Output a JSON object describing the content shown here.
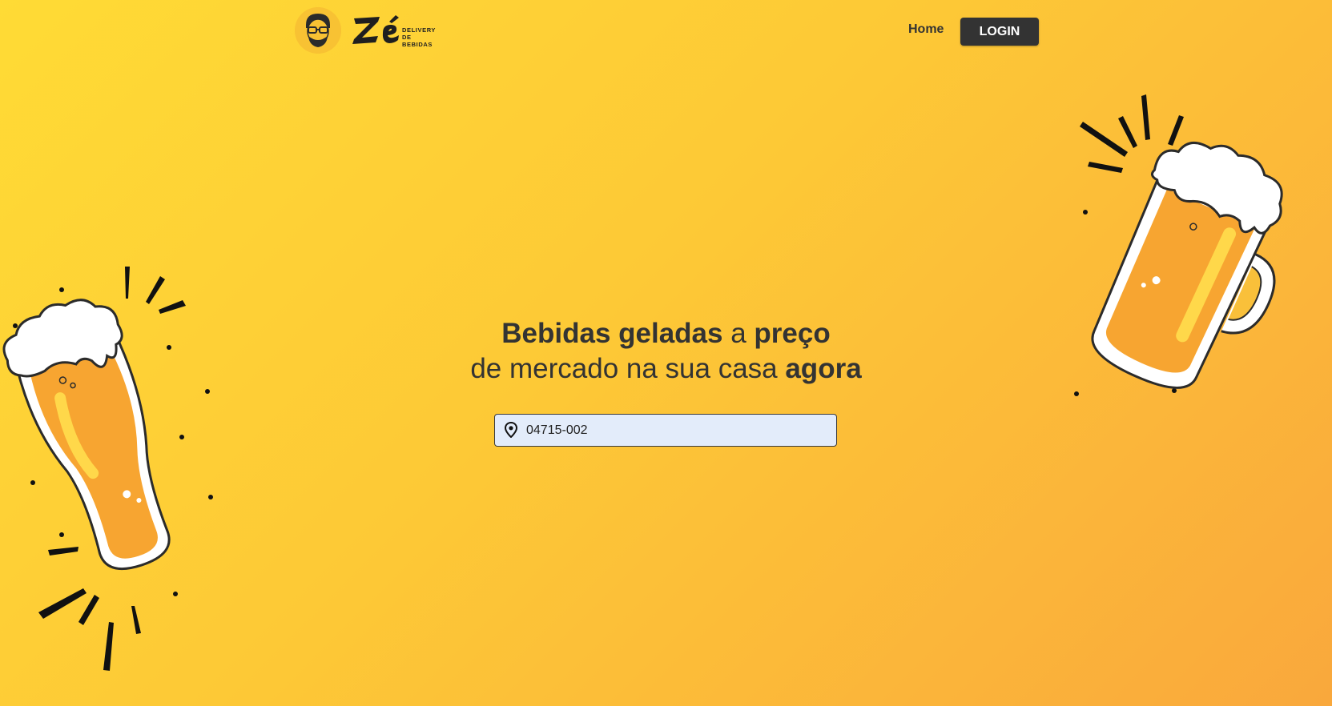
{
  "brand": {
    "logo_text": "Zé",
    "logo_subtitle_line1": "DELIVERY",
    "logo_subtitle_line2": "DE BEBIDAS"
  },
  "nav": {
    "home_label": "Home",
    "login_label": "LOGIN"
  },
  "hero": {
    "line1_bold1": "Bebidas geladas",
    "line1_light": " a ",
    "line1_bold2": "preço",
    "line2_light": "de mercado na sua casa ",
    "line2_bold": "agora"
  },
  "address_search": {
    "value": "04715-002",
    "icon": "location-pin-icon"
  },
  "colors": {
    "background_start": "#ffdb35",
    "background_end": "#f9a83c",
    "button_bg": "#333333",
    "input_bg": "#e3ecfa",
    "beer": "#f7a531",
    "foam": "#ffffff"
  }
}
